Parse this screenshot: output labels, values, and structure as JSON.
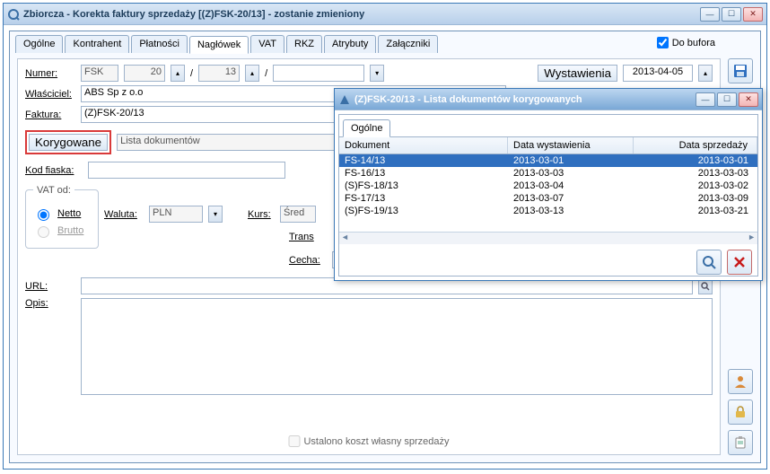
{
  "main": {
    "title": "Zbiorcza - Korekta faktury sprzedaży [(Z)FSK-20/13]  - zostanie zmieniony",
    "doBufora": "Do bufora",
    "tabs": [
      "Ogólne",
      "Kontrahent",
      "Płatności",
      "Nagłówek",
      "VAT",
      "RKZ",
      "Atrybuty",
      "Załączniki"
    ],
    "activeTab": "Nagłówek",
    "labels": {
      "numer": "Numer:",
      "wlasciciel": "Właściciel:",
      "faktura": "Faktura:",
      "korygowane": "Korygowane",
      "listaDokumentow": "Lista dokumentów",
      "kodFiaska": "Kod fiaska:",
      "vatOd": "VAT od:",
      "netto": "Netto",
      "brutto": "Brutto",
      "waluta": "Waluta:",
      "kurs": "Kurs:",
      "trans": "Trans",
      "cecha": "Cecha:",
      "url": "URL:",
      "opis": "Opis:",
      "wystawienia": "Wystawienia",
      "ustalono": "Ustalono koszt własny sprzedaży"
    },
    "values": {
      "numerPrefix": "FSK",
      "numerA": "20",
      "numerB": "13",
      "wlasciciel": "ABS Sp z o.o",
      "faktura": "(Z)FSK-20/13",
      "waluta": "PLN",
      "kurs": "Śred",
      "dataWyst": "2013-04-05"
    }
  },
  "dialog": {
    "title": "(Z)FSK-20/13 - Lista dokumentów korygowanych",
    "tab": "Ogólne",
    "columns": {
      "doc": "Dokument",
      "d1": "Data wystawienia",
      "d2": "Data sprzedaży"
    },
    "rows": [
      {
        "doc": "FS-14/13",
        "d1": "2013-03-01",
        "d2": "2013-03-01",
        "sel": true
      },
      {
        "doc": "FS-16/13",
        "d1": "2013-03-03",
        "d2": "2013-03-03",
        "sel": false
      },
      {
        "doc": "(S)FS-18/13",
        "d1": "2013-03-04",
        "d2": "2013-03-02",
        "sel": false
      },
      {
        "doc": "FS-17/13",
        "d1": "2013-03-07",
        "d2": "2013-03-09",
        "sel": false
      },
      {
        "doc": "(S)FS-19/13",
        "d1": "2013-03-13",
        "d2": "2013-03-21",
        "sel": false
      }
    ]
  }
}
